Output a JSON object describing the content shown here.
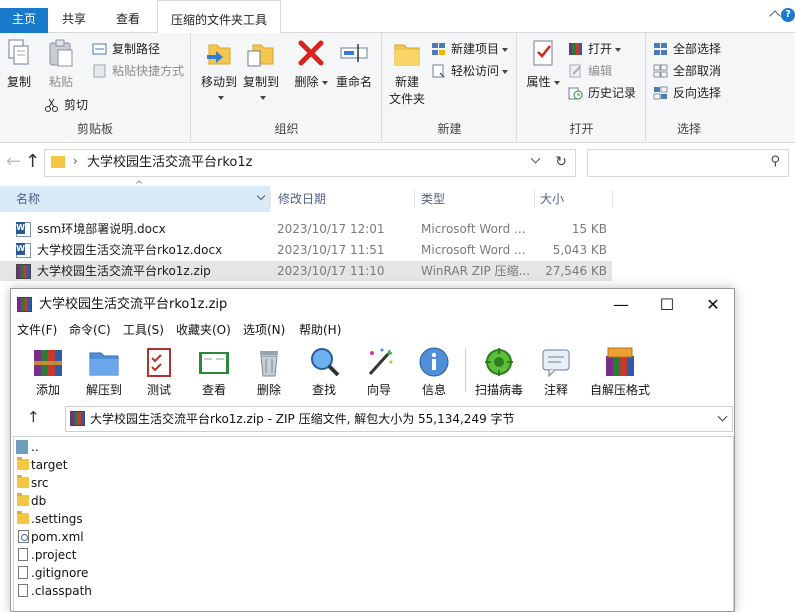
{
  "ribbon_tabs": {
    "home": "主页",
    "share": "共享",
    "view": "查看",
    "compressed_tools": "压缩的文件夹工具"
  },
  "ribbon": {
    "clipboard": {
      "copy": "复制",
      "paste": "粘贴",
      "copy_path": "复制路径",
      "paste_shortcut": "粘贴快捷方式",
      "cut": "剪切",
      "label": "剪贴板"
    },
    "organize": {
      "move_to": "移动到",
      "copy_to": "复制到",
      "delete": "删除",
      "rename": "重命名",
      "label": "组织"
    },
    "new": {
      "new_folder": "新建",
      "new_folder_line2": "文件夹",
      "new_item": "新建项目",
      "easy_access": "轻松访问",
      "label": "新建"
    },
    "open": {
      "properties": "属性",
      "open": "打开",
      "edit": "编辑",
      "history": "历史记录",
      "label": "打开"
    },
    "select": {
      "select_all": "全部选择",
      "select_none": "全部取消",
      "invert": "反向选择",
      "label": "选择"
    }
  },
  "address": {
    "path": "大学校园生活交流平台rko1z"
  },
  "list": {
    "headers": {
      "name": "名称",
      "date": "修改日期",
      "type": "类型",
      "size": "大小"
    },
    "files": [
      {
        "name": "ssm环境部署说明.docx",
        "date": "2023/10/17 12:01",
        "type": "Microsoft Word ...",
        "size": "15 KB",
        "icon": "word-doc-icon"
      },
      {
        "name": "大学校园生活交流平台rko1z.docx",
        "date": "2023/10/17 11:51",
        "type": "Microsoft Word ...",
        "size": "5,043 KB",
        "icon": "word-doc-icon"
      },
      {
        "name": "大学校园生活交流平台rko1z.zip",
        "date": "2023/10/17 11:10",
        "type": "WinRAR ZIP 压缩...",
        "size": "27,546 KB",
        "icon": "winrar-archive-icon"
      }
    ]
  },
  "winrar": {
    "title": "大学校园生活交流平台rko1z.zip",
    "menu": [
      "文件(F)",
      "命令(C)",
      "工具(S)",
      "收藏夹(O)",
      "选项(N)",
      "帮助(H)"
    ],
    "toolbar": [
      "添加",
      "解压到",
      "测试",
      "查看",
      "删除",
      "查找",
      "向导",
      "信息",
      "扫描病毒",
      "注释",
      "自解压格式"
    ],
    "path_text": "大学校园生活交流平台rko1z.zip - ZIP 压缩文件, 解包大小为 55,134,249 字节",
    "entries": [
      {
        "name": "..",
        "kind": "up"
      },
      {
        "name": "target",
        "kind": "folder"
      },
      {
        "name": "src",
        "kind": "folder"
      },
      {
        "name": "db",
        "kind": "folder"
      },
      {
        "name": ".settings",
        "kind": "folder"
      },
      {
        "name": "pom.xml",
        "kind": "xml"
      },
      {
        "name": ".project",
        "kind": "file"
      },
      {
        "name": ".gitignore",
        "kind": "file"
      },
      {
        "name": ".classpath",
        "kind": "file"
      }
    ]
  },
  "colors": {
    "accent": "#1979ca",
    "selected_header": "#d9ebf9",
    "selected_row": "#e5e5e5",
    "zip_tab_stripe": "#f6c9e3"
  }
}
